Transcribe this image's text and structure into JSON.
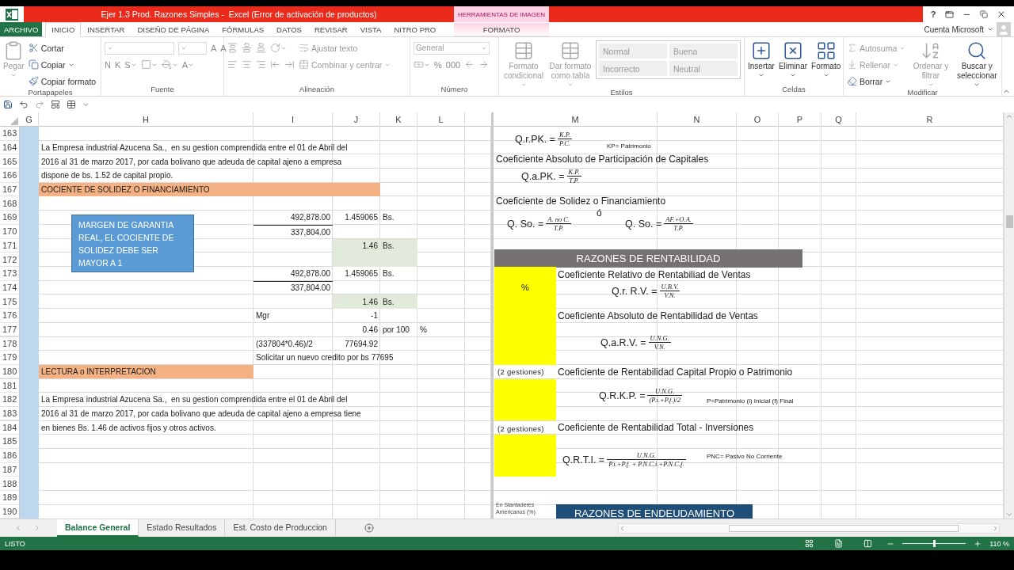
{
  "title_bar": {
    "title": "Ejer 1.3 Prod. Razones Simples -  Excel (Error de activación de productos)",
    "context_label": "HERRAMIENTAS DE IMAGEN",
    "help": "?"
  },
  "tabs": [
    {
      "label": "ARCHIVO",
      "kind": "file",
      "selected": false
    },
    {
      "label": "INICIO",
      "kind": "tab",
      "selected": true
    },
    {
      "label": "INSERTAR",
      "kind": "tab",
      "selected": false
    },
    {
      "label": "DISEÑO DE PÁGINA",
      "kind": "tab",
      "selected": false
    },
    {
      "label": "FÓRMULAS",
      "kind": "tab",
      "selected": false
    },
    {
      "label": "DATOS",
      "kind": "tab",
      "selected": false
    },
    {
      "label": "REVISAR",
      "kind": "tab",
      "selected": false
    },
    {
      "label": "VISTA",
      "kind": "tab",
      "selected": false
    },
    {
      "label": "NITRO PRO",
      "kind": "tab",
      "selected": false
    },
    {
      "label": "FORMATO",
      "kind": "contextual",
      "selected": false
    }
  ],
  "account": "Cuenta Microsoft",
  "ribbon": {
    "groups": [
      {
        "label": "Portapapeles",
        "items": [
          {
            "kind": "large",
            "label": "Pegar",
            "disabled": true,
            "dropdown": true
          },
          {
            "kind": "stack",
            "rows": [
              [
                {
                  "kind": "button",
                  "label": "Cortar",
                  "disabled": false,
                  "dropdown": false
                }
              ],
              [
                {
                  "kind": "button",
                  "label": "Copiar",
                  "disabled": false,
                  "dropdown": true
                }
              ],
              [
                {
                  "kind": "button",
                  "label": "Copiar formato",
                  "disabled": false,
                  "dropdown": false
                }
              ]
            ]
          }
        ]
      },
      {
        "label": "Fuente",
        "items": [
          {
            "kind": "stack",
            "rows": [
              [
                {
                  "kind": "field",
                  "disabled": true,
                  "dropdown": true
                },
                {
                  "kind": "field",
                  "disabled": true,
                  "dropdown": true
                },
                {
                  "kind": "glyph",
                  "label": "A",
                  "disabled": true,
                  "dropdown": false
                },
                {
                  "kind": "glyph",
                  "label": "A",
                  "disabled": true,
                  "dropdown": false
                }
              ],
              [
                {
                  "kind": "glyph",
                  "label": "N",
                  "disabled": true,
                  "dropdown": false
                },
                {
                  "kind": "glyph",
                  "label": "K",
                  "disabled": true,
                  "dropdown": false
                },
                {
                  "kind": "glyph",
                  "label": "S",
                  "disabled": true,
                  "dropdown": true
                },
                {
                  "kind": "icon",
                  "disabled": true,
                  "dropdown": true
                },
                {
                  "kind": "icon",
                  "disabled": true,
                  "dropdown": true
                },
                {
                  "kind": "glyph",
                  "label": "A",
                  "disabled": true,
                  "dropdown": true
                }
              ]
            ]
          }
        ]
      },
      {
        "label": "Alineación",
        "items": [
          {
            "kind": "stack",
            "rows": [
              [
                {
                  "kind": "icon",
                  "disabled": true,
                  "dropdown": false
                },
                {
                  "kind": "icon",
                  "disabled": true,
                  "dropdown": false
                },
                {
                  "kind": "icon",
                  "disabled": true,
                  "dropdown": false
                },
                {
                  "kind": "icon",
                  "disabled": true,
                  "dropdown": true
                }
              ],
              [
                {
                  "kind": "icon",
                  "disabled": true,
                  "dropdown": false
                },
                {
                  "kind": "icon",
                  "disabled": true,
                  "dropdown": false
                },
                {
                  "kind": "icon",
                  "disabled": true,
                  "dropdown": false
                },
                {
                  "kind": "icon",
                  "disabled": true,
                  "dropdown": false
                },
                {
                  "kind": "icon",
                  "disabled": true,
                  "dropdown": false
                }
              ]
            ]
          },
          {
            "kind": "stack",
            "rows": [
              [
                {
                  "kind": "button",
                  "label": "Ajustar texto",
                  "disabled": true,
                  "dropdown": false
                }
              ],
              [
                {
                  "kind": "button",
                  "label": "Combinar y centrar",
                  "disabled": true,
                  "dropdown": true
                }
              ]
            ]
          }
        ]
      },
      {
        "label": "Número",
        "items": [
          {
            "kind": "stack",
            "rows": [
              [
                {
                  "kind": "field",
                  "value": "General",
                  "disabled": true,
                  "dropdown": true
                }
              ],
              [
                {
                  "kind": "icon",
                  "disabled": true,
                  "dropdown": true
                },
                {
                  "kind": "glyph",
                  "label": "%",
                  "disabled": true,
                  "dropdown": false
                },
                {
                  "kind": "glyph",
                  "label": "000",
                  "disabled": true,
                  "dropdown": false
                },
                {
                  "kind": "icon",
                  "disabled": true,
                  "dropdown": false
                },
                {
                  "kind": "icon",
                  "disabled": true,
                  "dropdown": false
                }
              ]
            ]
          }
        ]
      },
      {
        "label": "Estilos",
        "items": [
          {
            "kind": "large",
            "label": "Formato condicional",
            "disabled": true,
            "dropdown": true
          },
          {
            "kind": "large",
            "label": "Dar formato como tabla",
            "disabled": true,
            "dropdown": true
          },
          {
            "kind": "gallery",
            "styles": [
              "Normal",
              "Buena",
              "Incorrecto",
              "Neutral"
            ],
            "disabled": true
          }
        ]
      },
      {
        "label": "Celdas",
        "items": [
          {
            "kind": "large",
            "label": "Insertar",
            "disabled": false,
            "dropdown": true
          },
          {
            "kind": "large",
            "label": "Eliminar",
            "disabled": false,
            "dropdown": true
          },
          {
            "kind": "large",
            "label": "Formato",
            "disabled": false,
            "dropdown": true
          }
        ]
      },
      {
        "label": "Modificar",
        "items": [
          {
            "kind": "stack",
            "rows": [
              [
                {
                  "kind": "button",
                  "label": "Autosuma",
                  "disabled": true,
                  "dropdown": true
                }
              ],
              [
                {
                  "kind": "button",
                  "label": "Rellenar",
                  "disabled": true,
                  "dropdown": true
                }
              ],
              [
                {
                  "kind": "button",
                  "label": "Borrar",
                  "disabled": false,
                  "dropdown": true
                }
              ]
            ]
          },
          {
            "kind": "large",
            "label": "Ordenar y filtrar",
            "disabled": true,
            "dropdown": true
          },
          {
            "kind": "large",
            "label": "Buscar y seleccionar",
            "disabled": false,
            "dropdown": true
          }
        ]
      }
    ]
  },
  "sheet": {
    "columns": [
      {
        "label": "G",
        "color": "#bdd7ee"
      },
      {
        "label": "H"
      },
      {
        "label": "I"
      },
      {
        "label": "J"
      },
      {
        "label": "K"
      },
      {
        "label": "L"
      },
      {
        "label": "M"
      },
      {
        "label": "N"
      },
      {
        "label": "O"
      },
      {
        "label": "P"
      },
      {
        "label": "Q"
      },
      {
        "label": "R"
      }
    ],
    "rows": [
      {
        "header": "163"
      },
      {
        "header": "164",
        "cells": {
          "H": {
            "text": "La Empresa industrial Azucena Sa.,  en su gestion comprendida entre el 01 de Abril del"
          }
        }
      },
      {
        "header": "165",
        "cells": {
          "H": {
            "text": "2016 al 31 de marzo 2017, por cada bolivano que adeuda de capital ajeno a empresa"
          }
        }
      },
      {
        "header": "166",
        "cells": {
          "H": {
            "text": "dispone de bs. 1.52 de capital propio."
          }
        }
      },
      {
        "header": "167",
        "cells": {
          "H": {
            "text": "COCIENTE DE SOLIDEZ O FINANCIAMIENTO",
            "color": "#f4b183"
          },
          "I": {
            "color": "#f4b183"
          },
          "J": {
            "color": "#f4b183"
          }
        }
      },
      {
        "header": "168"
      },
      {
        "header": "169",
        "cells": {
          "I": {
            "text": "492,878.00",
            "kind": "number"
          },
          "J": {
            "text": "1.459065",
            "kind": "number"
          },
          "K": {
            "text": "Bs."
          }
        }
      },
      {
        "header": "170",
        "cells": {
          "I": {
            "text": "337,804.00",
            "kind": "number",
            "rule_above": true
          }
        }
      },
      {
        "header": "171",
        "cells": {
          "J": {
            "text": "1.46",
            "kind": "number",
            "color": "#e2eadb"
          },
          "K": {
            "text": "Bs.",
            "color": "#e2eadb"
          }
        }
      },
      {
        "header": "172",
        "cells": {
          "J": {
            "color": "#e2eadb"
          },
          "K": {
            "color": "#e2eadb"
          }
        }
      },
      {
        "header": "173",
        "cells": {
          "I": {
            "text": "492,878.00",
            "kind": "number"
          },
          "J": {
            "text": "1.459065",
            "kind": "number"
          },
          "K": {
            "text": "Bs."
          }
        }
      },
      {
        "header": "174",
        "cells": {
          "I": {
            "text": "337,804.00",
            "kind": "number",
            "rule_above": true
          }
        }
      },
      {
        "header": "175",
        "cells": {
          "J": {
            "text": "1.46",
            "kind": "number",
            "color": "#e2eadb"
          },
          "K": {
            "text": "Bs.",
            "color": "#e2eadb"
          }
        }
      },
      {
        "header": "176",
        "cells": {
          "I": {
            "text": "Mgr"
          },
          "J": {
            "text": "-1",
            "kind": "number"
          }
        }
      },
      {
        "header": "177",
        "cells": {
          "J": {
            "text": "0.46",
            "kind": "number"
          },
          "K": {
            "text": "por 100"
          },
          "L": {
            "text": "%"
          }
        }
      },
      {
        "header": "178",
        "cells": {
          "I": {
            "text": "(337804*0.46)/2"
          },
          "J": {
            "text": "77694.92",
            "kind": "number"
          }
        }
      },
      {
        "header": "179",
        "cells": {
          "I": {
            "text": "Solicitar un nuevo credito por bs 77695"
          }
        }
      },
      {
        "header": "180",
        "cells": {
          "H": {
            "text": "LECTURA o INTERPRETACION",
            "color": "#f4b183"
          }
        }
      },
      {
        "header": "181"
      },
      {
        "header": "182",
        "cells": {
          "H": {
            "text": "La Empresa industrial Azucena Sa.,  en su gestion comprendida entre el 01 de Abril del"
          }
        }
      },
      {
        "header": "183",
        "cells": {
          "H": {
            "text": "2016 al 31 de marzo 2017, por cada bolivano que adeuda de capital ajeno a empresa tiene"
          }
        }
      },
      {
        "header": "184",
        "cells": {
          "H": {
            "text": "en bienes Bs. 1.46 de activos fijos y otros activos."
          }
        }
      },
      {
        "header": "185"
      },
      {
        "header": "186"
      },
      {
        "header": "187"
      },
      {
        "header": "188"
      },
      {
        "header": "189"
      },
      {
        "header": "190"
      }
    ],
    "textbox": {
      "text": "MARGEN DE GARANTIA REAL, EL COCIENTE DE SOLIDEZ DEBE SER MAYOR A 1",
      "color": "#5b9bd5"
    },
    "objects": [
      {
        "kind": "formula",
        "label": "Q.r.PK. =",
        "numerator": "K.P.",
        "denominator": "P.C."
      },
      {
        "kind": "note",
        "text": "KP= Patrimonio"
      },
      {
        "kind": "heading",
        "text": "Coeficiente Absoluto de Participación de Capitales"
      },
      {
        "kind": "formula",
        "label": "Q.a.PK. =",
        "numerator": "K.P.",
        "denominator": "T.P."
      },
      {
        "kind": "heading",
        "text": "Coeficiente de Solidez o Financiamiento"
      },
      {
        "kind": "heading",
        "text": "ó"
      },
      {
        "kind": "formula",
        "label": "Q. So. =",
        "numerator": "A. no C.",
        "denominator": "T.P."
      },
      {
        "kind": "formula",
        "label": "Q. So. =",
        "numerator": "AF.+O.A.",
        "denominator": "T.P."
      },
      {
        "kind": "banner",
        "text": "RAZONES DE RENTABILIDAD",
        "color": "#767171"
      },
      {
        "kind": "marker",
        "text": "%",
        "color": "#ffff00"
      },
      {
        "kind": "heading",
        "text": "Coeficiente Relativo de Rentabiliad de Ventas"
      },
      {
        "kind": "formula",
        "label": "Q.r. R.V. =",
        "numerator": "U.B.V.",
        "denominator": "V.N."
      },
      {
        "kind": "heading",
        "text": "Coeficiente Absoluto de Rentabilidad de Ventas"
      },
      {
        "kind": "formula",
        "label": "Q.a.R.V. =",
        "numerator": "U.N.G.",
        "denominator": "V.N."
      },
      {
        "kind": "tag",
        "text": "(2 gestiones)"
      },
      {
        "kind": "heading",
        "text": "Coeficiente de Rentabilidad Capital Propio o Patrimonio"
      },
      {
        "kind": "marker",
        "color": "#ffff00"
      },
      {
        "kind": "formula",
        "label": "Q.R.K.P. =",
        "numerator": "U.N.G.",
        "denominator": "(P.i.+P.f.)/2"
      },
      {
        "kind": "note",
        "text": "P=Patrimonio (i) Inicial (f) Final"
      },
      {
        "kind": "tag",
        "text": "(2 gestiones)"
      },
      {
        "kind": "heading",
        "text": "Coeficiente de Rentabilidad Total - Inversiones"
      },
      {
        "kind": "marker",
        "color": "#ffff00"
      },
      {
        "kind": "formula",
        "label": "Q.R.T.I. =",
        "numerator": "U.N.G.",
        "denominator": "P.i.+P.f. + P.N.C.i.+P.N.C.f."
      },
      {
        "kind": "note",
        "text": "PNC= Pasivo No Corriente"
      },
      {
        "kind": "caption",
        "text": "En Stantaderes Americanos (%)"
      },
      {
        "kind": "banner",
        "text": "RAZONES DE ENDEUDAMIENTO",
        "color": "#1f4e79"
      }
    ]
  },
  "sheet_tabs": [
    {
      "label": "Balance General",
      "selected": true
    },
    {
      "label": "Estado Resultados",
      "selected": false
    },
    {
      "label": "Est. Costo de Produccion",
      "selected": false
    }
  ],
  "status_bar": {
    "status": "LISTO",
    "zoom": "110 %",
    "zoom_slider": {
      "level": 0.5
    }
  }
}
